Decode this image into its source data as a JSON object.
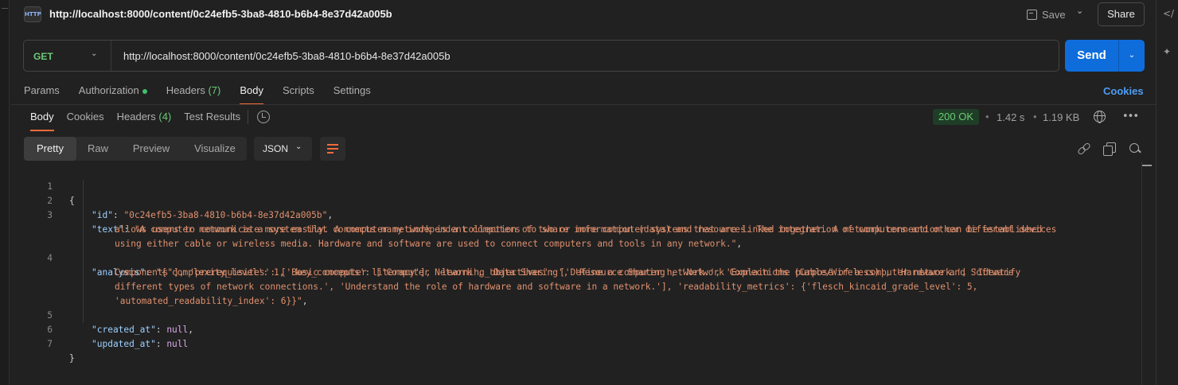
{
  "request": {
    "title": "http://localhost:8000/content/0c24efb5-3ba8-4810-b6b4-8e37d42a005b",
    "icon_label": "HTTP",
    "save_label": "Save",
    "share_label": "Share",
    "method": "GET",
    "url": "http://localhost:8000/content/0c24efb5-3ba8-4810-b6b4-8e37d42a005b",
    "send_label": "Send"
  },
  "request_tabs": {
    "params": "Params",
    "authorization": "Authorization",
    "headers": "Headers",
    "headers_count": "(7)",
    "body": "Body",
    "scripts": "Scripts",
    "settings": "Settings",
    "cookies_link": "Cookies"
  },
  "response_tabs": {
    "body": "Body",
    "cookies": "Cookies",
    "headers": "Headers",
    "headers_count": "(4)",
    "test_results": "Test Results"
  },
  "response_meta": {
    "status": "200 OK",
    "time": "1.42 s",
    "size": "1.19 KB"
  },
  "view": {
    "modes": [
      "Pretty",
      "Raw",
      "Preview",
      "Visualize"
    ],
    "active_mode": "Pretty",
    "format": "JSON"
  },
  "code": {
    "line_numbers": [
      "1",
      "2",
      "3",
      "4",
      "5",
      "6",
      "7"
    ],
    "open_brace": "{",
    "close_brace": "}",
    "id_key": "\"id\"",
    "id_value": "\"0c24efb5-3ba8-4810-b6b4-8e37d42a005b\"",
    "text_key": "\"text\"",
    "text_value_1": "\"A computer network is a system that connects many independent computers to share information (data) and resources. The integration of computers and other different devices",
    "text_value_2": "allows users to communicate more easily. A computer network is a collection of two or more computer systems that are linked together. A network connection can be established",
    "text_value_3": "using either cable or wireless media. Hardware and software are used to connect computers and tools in any network.\"",
    "analysis_key": "\"analysis\"",
    "analysis_value_1": "\"{'complexity_level': 1, 'key_concepts': ['Computer Network', 'Data Sharing', 'Resource Sharing', 'Network Connections (Cable/Wireless)', 'Hardware and Software",
    "analysis_value_2": "Components'], 'prerequisites': ['Basic computer literacy'], 'learning_objectives': ['Define a computer network.', 'Explain the purpose of a computer network.', 'Identify",
    "analysis_value_3": "different types of network connections.', 'Understand the role of hardware and software in a network.'], 'readability_metrics': {'flesch_kincaid_grade_level': 5,",
    "analysis_value_4": "'automated_readability_index': 6}}\"",
    "created_key": "\"created_at\"",
    "updated_key": "\"updated_at\"",
    "null_value": "null"
  },
  "colors": {
    "accent": "#f26b3a",
    "send": "#0f6ddb",
    "success": "#6bcb77",
    "link": "#4d9ef7"
  }
}
